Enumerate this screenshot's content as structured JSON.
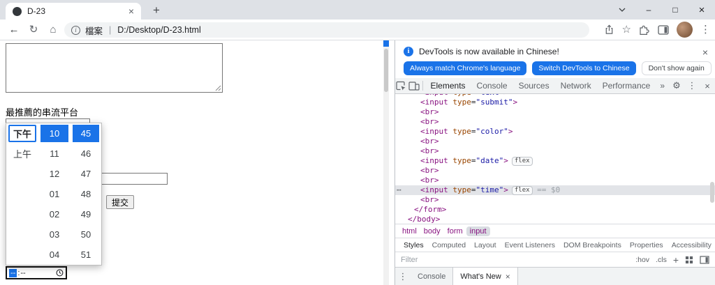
{
  "colors": {
    "accent_blue": "#1A73E8",
    "code_tag": "#881280",
    "code_attr": "#994500",
    "code_value": "#1A1AA6",
    "selected_line_bg": "#E2E4E8"
  },
  "icons": {
    "close": "×",
    "new_tab": "+",
    "minimize": "–",
    "maximize": "□",
    "back": "←",
    "reload": "↻",
    "home": "⌂",
    "star": "☆",
    "kebab": "⋮",
    "gear": "⚙",
    "overflow": "»",
    "ellipsis": "⋯",
    "info_letter": "i"
  },
  "browser": {
    "tab_title": "D-23",
    "url_file_label": "檔案",
    "url_separator": "|",
    "url_path": "D:/Desktop/D-23.html"
  },
  "page": {
    "question_label": "最推薦的串流平台",
    "textarea_value": "",
    "text_input_value": "",
    "submit_label": "提交",
    "time_input": {
      "hour": "--",
      "separator": ":",
      "minute": "--"
    },
    "time_picker": {
      "meridiem": [
        "下午",
        "上午"
      ],
      "hours": [
        "10",
        "11",
        "12",
        "01",
        "02",
        "03",
        "04"
      ],
      "minutes": [
        "45",
        "46",
        "47",
        "48",
        "49",
        "50",
        "51"
      ],
      "selected": {
        "meridiem": "下午",
        "hour": "10",
        "minute": "45"
      }
    }
  },
  "devtools": {
    "notification": {
      "message": "DevTools is now available in Chinese!",
      "primary_button": "Always match Chrome's language",
      "secondary_button": "Switch DevTools to Chinese",
      "dismiss_button": "Don't show again"
    },
    "main_tabs": [
      "Elements",
      "Console",
      "Sources",
      "Network",
      "Performance"
    ],
    "code_lines": [
      {
        "indent": 3,
        "clipped": true,
        "tokens": [
          {
            "t": "<input ",
            "c": "tag"
          },
          {
            "t": "type",
            "c": "attr"
          },
          {
            "t": "=",
            "c": "plain"
          },
          {
            "t": "\"text\"",
            "c": "val"
          },
          {
            "t": ">",
            "c": "tag"
          }
        ]
      },
      {
        "indent": 3,
        "tokens": [
          {
            "t": "<input ",
            "c": "tag"
          },
          {
            "t": "type",
            "c": "attr"
          },
          {
            "t": "=",
            "c": "plain"
          },
          {
            "t": "\"submit\"",
            "c": "val"
          },
          {
            "t": ">",
            "c": "tag"
          }
        ]
      },
      {
        "indent": 3,
        "tokens": [
          {
            "t": "<br>",
            "c": "tag"
          }
        ]
      },
      {
        "indent": 3,
        "tokens": [
          {
            "t": "<br>",
            "c": "tag"
          }
        ]
      },
      {
        "indent": 3,
        "tokens": [
          {
            "t": "<input ",
            "c": "tag"
          },
          {
            "t": "type",
            "c": "attr"
          },
          {
            "t": "=",
            "c": "plain"
          },
          {
            "t": "\"color\"",
            "c": "val"
          },
          {
            "t": ">",
            "c": "tag"
          }
        ]
      },
      {
        "indent": 3,
        "tokens": [
          {
            "t": "<br>",
            "c": "tag"
          }
        ]
      },
      {
        "indent": 3,
        "tokens": [
          {
            "t": "<br>",
            "c": "tag"
          }
        ]
      },
      {
        "indent": 3,
        "tokens": [
          {
            "t": "<input ",
            "c": "tag"
          },
          {
            "t": "type",
            "c": "attr"
          },
          {
            "t": "=",
            "c": "plain"
          },
          {
            "t": "\"date\"",
            "c": "val"
          },
          {
            "t": ">",
            "c": "tag"
          },
          {
            "t": "flex",
            "c": "badge"
          }
        ]
      },
      {
        "indent": 3,
        "tokens": [
          {
            "t": "<br>",
            "c": "tag"
          }
        ]
      },
      {
        "indent": 3,
        "tokens": [
          {
            "t": "<br>",
            "c": "tag"
          }
        ]
      },
      {
        "indent": 3,
        "selected": true,
        "tokens": [
          {
            "t": "<input ",
            "c": "tag"
          },
          {
            "t": "type",
            "c": "attr"
          },
          {
            "t": "=",
            "c": "plain"
          },
          {
            "t": "\"time\"",
            "c": "val"
          },
          {
            "t": ">",
            "c": "tag"
          },
          {
            "t": "flex",
            "c": "badge"
          },
          {
            "t": " == $0",
            "c": "anno"
          }
        ]
      },
      {
        "indent": 3,
        "tokens": [
          {
            "t": "<br>",
            "c": "tag"
          }
        ]
      },
      {
        "indent": 2,
        "tokens": [
          {
            "t": "</form>",
            "c": "tag"
          }
        ]
      },
      {
        "indent": 1,
        "tokens": [
          {
            "t": "</body>",
            "c": "tag"
          }
        ]
      }
    ],
    "breadcrumb": {
      "items": [
        "html",
        "body",
        "form",
        "input"
      ],
      "selected": "input"
    },
    "sidebar_tabs": [
      "Styles",
      "Computed",
      "Layout",
      "Event Listeners",
      "DOM Breakpoints",
      "Properties",
      "Accessibility"
    ],
    "filter_placeholder": "Filter",
    "style_toolbar": {
      "pseudo": ":hov",
      "cls": ".cls",
      "add": "+"
    },
    "drawer": {
      "menu_icon": "⋮",
      "tabs": [
        "Console",
        "What's New"
      ],
      "active_tab": "What's New"
    }
  }
}
